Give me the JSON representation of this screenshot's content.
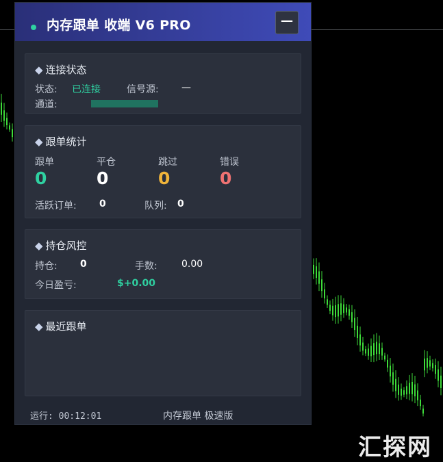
{
  "colors": {
    "accent_green": "#2fd1a1",
    "yellow": "#f0b43a",
    "red": "#ef7272",
    "title_bg": "#3f4bb8"
  },
  "window": {
    "title": "内存跟单 收端 V6 PRO",
    "minimize_label": "−"
  },
  "connection": {
    "title": "连接状态",
    "status_label": "状态:",
    "status_value": "已连接",
    "signal_label": "信号源:",
    "signal_value": "—",
    "channel_label": "通道:"
  },
  "stats": {
    "title": "跟单统计",
    "items": [
      {
        "label": "跟单",
        "value": "0"
      },
      {
        "label": "平仓",
        "value": "0"
      },
      {
        "label": "跳过",
        "value": "0"
      },
      {
        "label": "错误",
        "value": "0"
      }
    ],
    "active_orders_label": "活跃订单:",
    "active_orders_value": "0",
    "queue_label": "队列:",
    "queue_value": "0"
  },
  "position": {
    "title": "持仓风控",
    "hold_label": "持仓:",
    "hold_value": "0",
    "lots_label": "手数:",
    "lots_value": "0.00",
    "pnl_label": "今日盈亏:",
    "pnl_value": "$+0.00"
  },
  "recent": {
    "title": "最近跟单"
  },
  "footer": {
    "left": "运行: 00:12:01",
    "right": "内存跟单 极速版"
  },
  "watermark": "汇探网"
}
